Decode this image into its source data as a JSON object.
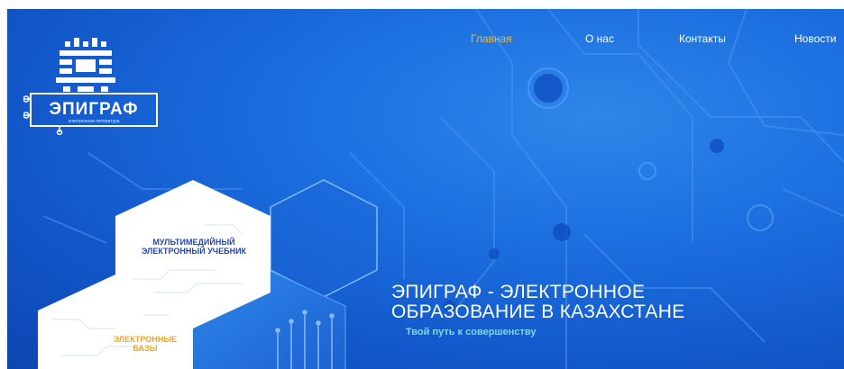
{
  "brand": {
    "name": "ЭПИГРАФ",
    "subtitle": "электронная литература"
  },
  "nav": {
    "items": [
      {
        "label": "Главная",
        "active": true
      },
      {
        "label": "О нас",
        "active": false
      },
      {
        "label": "Контакты",
        "active": false
      },
      {
        "label": "Новости",
        "active": false
      }
    ]
  },
  "tiles": {
    "multimedia": "МУЛЬТИМЕДИЙНЫЙ ЭЛЕКТРОННЫЙ УЧЕБНИК",
    "databases": "ЭЛЕКТРОННЫЕ БАЗЫ"
  },
  "hero": {
    "headline_line1": "ЭПИГРАФ - ЭЛЕКТРОННОЕ",
    "headline_line2": "ОБРАЗОВАНИЕ В КАЗАХСТАНЕ",
    "tagline": "Твой путь к совершенству"
  },
  "colors": {
    "background": "#1c6fe0",
    "nav_active": "#f5b82e",
    "tagline": "#7fd8e8",
    "tile_text_dark": "#2747a8",
    "tile_text_gold": "#e8a52b"
  }
}
